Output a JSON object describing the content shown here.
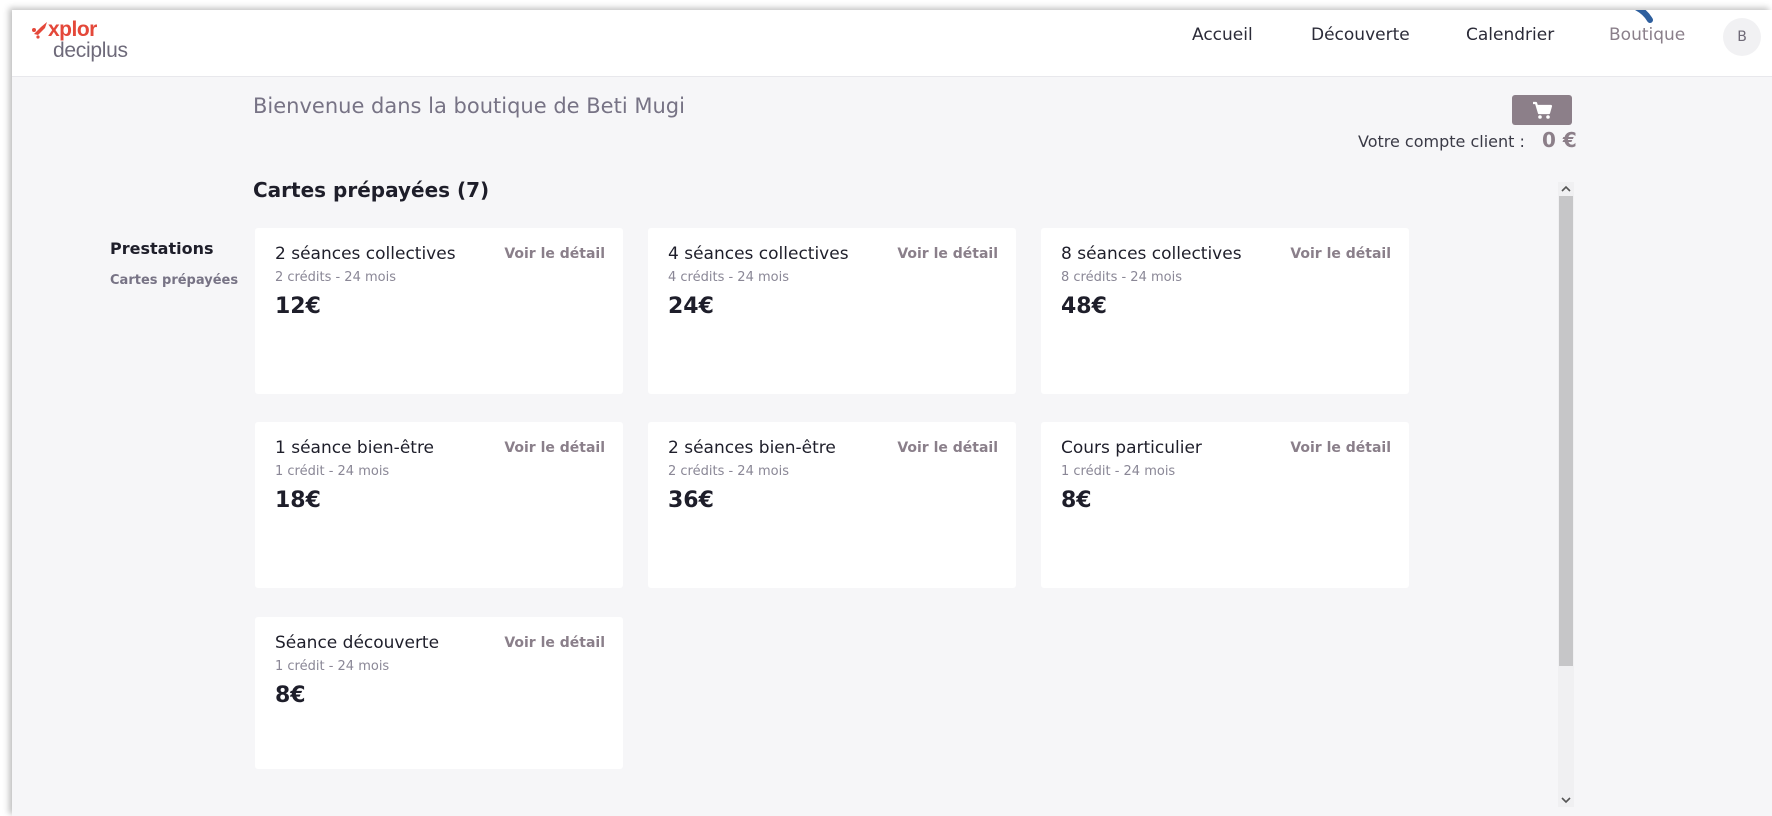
{
  "logo": {
    "line1": "xplor",
    "line2": "deciplus",
    "color": "#e4483a"
  },
  "nav": {
    "items": [
      {
        "label": "Accueil"
      },
      {
        "label": "Découverte"
      },
      {
        "label": "Calendrier"
      },
      {
        "label": "Boutique",
        "active": true
      }
    ],
    "avatar_initial": "B"
  },
  "welcome_text": "Bienvenue dans la boutique de  Beti Mugi",
  "cart": {
    "icon": "shopping-cart-icon"
  },
  "account": {
    "label": "Votre compte client :",
    "amount": "0 €"
  },
  "section_title": "Cartes prépayées (7)",
  "sidebar": {
    "title": "Prestations",
    "links": [
      "Cartes prépayées"
    ]
  },
  "cards": [
    {
      "title": "2 séances collectives",
      "detail": "Voir le détail",
      "sub": "2 crédits - 24 mois",
      "price": "12€"
    },
    {
      "title": "4 séances collectives",
      "detail": "Voir le détail",
      "sub": "4 crédits - 24 mois",
      "price": "24€"
    },
    {
      "title": "8 séances collectives",
      "detail": "Voir le détail",
      "sub": "8 crédits - 24 mois",
      "price": "48€"
    },
    {
      "title": "1 séance bien-être",
      "detail": "Voir le détail",
      "sub": "1 crédit - 24 mois",
      "price": "18€"
    },
    {
      "title": "2 séances bien-être",
      "detail": "Voir le détail",
      "sub": "2 crédits - 24 mois",
      "price": "36€"
    },
    {
      "title": "Cours particulier",
      "detail": "Voir le détail",
      "sub": "1 crédit - 24 mois",
      "price": "8€"
    },
    {
      "title": "Séance découverte",
      "detail": "Voir le détail",
      "sub": "1 crédit - 24 mois",
      "price": "8€"
    }
  ],
  "colors": {
    "accent": "#8c7f89",
    "background": "#f6f6f8",
    "brand": "#e4483a"
  }
}
